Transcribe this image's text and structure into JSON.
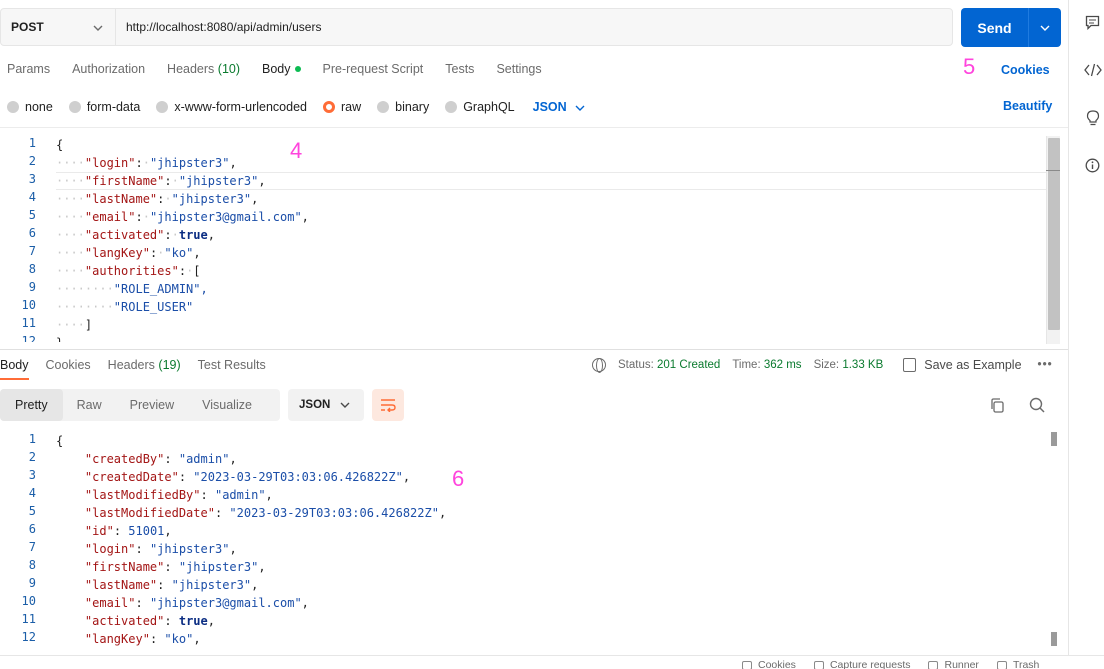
{
  "request": {
    "method": "POST",
    "url": "http://localhost:8080/api/admin/users",
    "send_label": "Send"
  },
  "request_tabs": [
    {
      "label": "Params"
    },
    {
      "label": "Authorization"
    },
    {
      "label": "Headers",
      "count": "(10)"
    },
    {
      "label": "Body"
    },
    {
      "label": "Pre-request Script"
    },
    {
      "label": "Tests"
    },
    {
      "label": "Settings"
    }
  ],
  "cookies_label": "Cookies",
  "annotations": {
    "four": "4",
    "five": "5",
    "six": "6"
  },
  "body_types": [
    "none",
    "form-data",
    "x-www-form-urlencoded",
    "raw",
    "binary",
    "GraphQL"
  ],
  "body_format": "JSON",
  "beautify_label": "Beautify",
  "request_line_numbers": [
    "1",
    "2",
    "3",
    "4",
    "5",
    "6",
    "7",
    "8",
    "9",
    "10",
    "11",
    "12"
  ],
  "request_body": [
    {
      "indent": 0,
      "text": "{"
    },
    {
      "indent": 1,
      "key": "\"login\"",
      "value": "\"jhipster3\"",
      "type": "s",
      "comma": ","
    },
    {
      "indent": 1,
      "key": "\"firstName\"",
      "value": "\"jhipster3\"",
      "type": "s",
      "comma": ","
    },
    {
      "indent": 1,
      "key": "\"lastName\"",
      "value": "\"jhipster3\"",
      "type": "s",
      "comma": ","
    },
    {
      "indent": 1,
      "key": "\"email\"",
      "value": "\"jhipster3@gmail.com\"",
      "type": "s",
      "comma": ","
    },
    {
      "indent": 1,
      "key": "\"activated\"",
      "value": "true",
      "type": "b",
      "comma": ","
    },
    {
      "indent": 1,
      "key": "\"langKey\"",
      "value": "\"ko\"",
      "type": "s",
      "comma": ","
    },
    {
      "indent": 1,
      "key": "\"authorities\"",
      "value": "[",
      "type": "p",
      "comma": ""
    },
    {
      "indent": 2,
      "text": "\"ROLE_ADMIN\",",
      "type": "s"
    },
    {
      "indent": 2,
      "text": "\"ROLE_USER\"",
      "type": "s"
    },
    {
      "indent": 1,
      "text": "]"
    },
    {
      "indent": 0,
      "text": "}"
    }
  ],
  "response_tabs": [
    {
      "label": "Body"
    },
    {
      "label": "Cookies"
    },
    {
      "label": "Headers",
      "count": "(19)"
    },
    {
      "label": "Test Results"
    }
  ],
  "response_status": {
    "status_label": "Status:",
    "status_value": "201 Created",
    "time_label": "Time:",
    "time_value": "362 ms",
    "size_label": "Size:",
    "size_value": "1.33 KB",
    "save_label": "Save as Example",
    "more": "•••"
  },
  "view_modes": [
    "Pretty",
    "Raw",
    "Preview",
    "Visualize"
  ],
  "response_format": "JSON",
  "response_line_numbers": [
    "1",
    "2",
    "3",
    "4",
    "5",
    "6",
    "7",
    "8",
    "9",
    "10",
    "11",
    "12"
  ],
  "response_body": [
    {
      "text": "{"
    },
    {
      "key": "\"createdBy\"",
      "value": "\"admin\"",
      "type": "s",
      "comma": ","
    },
    {
      "key": "\"createdDate\"",
      "value": "\"2023-03-29T03:03:06.426822Z\"",
      "type": "s",
      "comma": ","
    },
    {
      "key": "\"lastModifiedBy\"",
      "value": "\"admin\"",
      "type": "s",
      "comma": ","
    },
    {
      "key": "\"lastModifiedDate\"",
      "value": "\"2023-03-29T03:03:06.426822Z\"",
      "type": "s",
      "comma": ","
    },
    {
      "key": "\"id\"",
      "value": "51001",
      "type": "n",
      "comma": ","
    },
    {
      "key": "\"login\"",
      "value": "\"jhipster3\"",
      "type": "s",
      "comma": ","
    },
    {
      "key": "\"firstName\"",
      "value": "\"jhipster3\"",
      "type": "s",
      "comma": ","
    },
    {
      "key": "\"lastName\"",
      "value": "\"jhipster3\"",
      "type": "s",
      "comma": ","
    },
    {
      "key": "\"email\"",
      "value": "\"jhipster3@gmail.com\"",
      "type": "s",
      "comma": ","
    },
    {
      "key": "\"activated\"",
      "value": "true",
      "type": "b",
      "comma": ","
    },
    {
      "key": "\"langKey\"",
      "value": "\"ko\"",
      "type": "s",
      "comma": ","
    }
  ],
  "statusbar": [
    "Cookies",
    "Capture requests",
    "Runner",
    "Trash"
  ]
}
